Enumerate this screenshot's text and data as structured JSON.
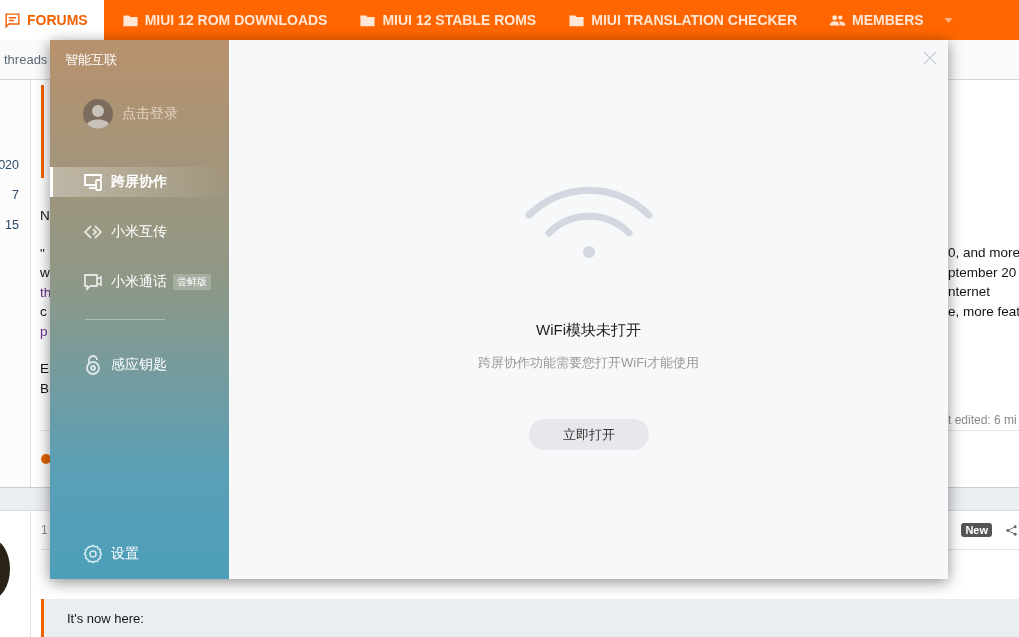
{
  "nav": {
    "tabs": [
      {
        "label": "FORUMS",
        "kind": "forums",
        "selected": true
      },
      {
        "label": "MIUI 12 ROM DOWNLOADS",
        "kind": "folder",
        "selected": false
      },
      {
        "label": "MIUI 12 STABLE ROMS",
        "kind": "folder",
        "selected": false
      },
      {
        "label": "MIUI TRANSLATION CHECKER",
        "kind": "folder",
        "selected": false
      },
      {
        "label": "MEMBERS",
        "kind": "members",
        "selected": false
      }
    ]
  },
  "breadcrumb": "threads",
  "thread_stats": [
    "020",
    "7",
    "15"
  ],
  "post": {
    "left_paragraphs": [
      [
        {
          "text": "N",
          "link": false
        }
      ],
      [
        {
          "text": "\"",
          "link": false
        },
        {
          "text": "w",
          "link": false
        },
        {
          "text": "th",
          "link": true
        },
        {
          "text": "c",
          "link": false
        },
        {
          "text": "p",
          "link": true
        }
      ],
      [
        {
          "text": "E",
          "link": false
        },
        {
          "text": "B",
          "link": false
        }
      ]
    ],
    "right_fragments": [
      {
        "text": "0, and more",
        "link": false
      },
      {
        "text": "ptember 20",
        "link": false
      },
      {
        "text": "nternet",
        "link": false
      },
      {
        "text": "e, more feat",
        "link": false
      }
    ],
    "edited": "t edited: 6 mi"
  },
  "next_post": {
    "number": "1",
    "badge": "New",
    "quote": "It's now here:"
  },
  "dialog": {
    "title": "智能互联",
    "login": "点击登录",
    "nav_groups": [
      [
        {
          "label": "跨屏协作",
          "kind": "screens",
          "selected": true
        },
        {
          "label": "小米互传",
          "kind": "transfer",
          "selected": false
        },
        {
          "label": "小米通话",
          "kind": "call",
          "selected": false,
          "badge": "尝鲜版"
        }
      ],
      [
        {
          "label": "感应钥匙",
          "kind": "key",
          "selected": false
        }
      ]
    ],
    "settings": "设置",
    "message": {
      "title": "WiFi模块未打开",
      "subtitle": "跨屏协作功能需要您打开WiFi才能使用",
      "button": "立即打开"
    }
  }
}
